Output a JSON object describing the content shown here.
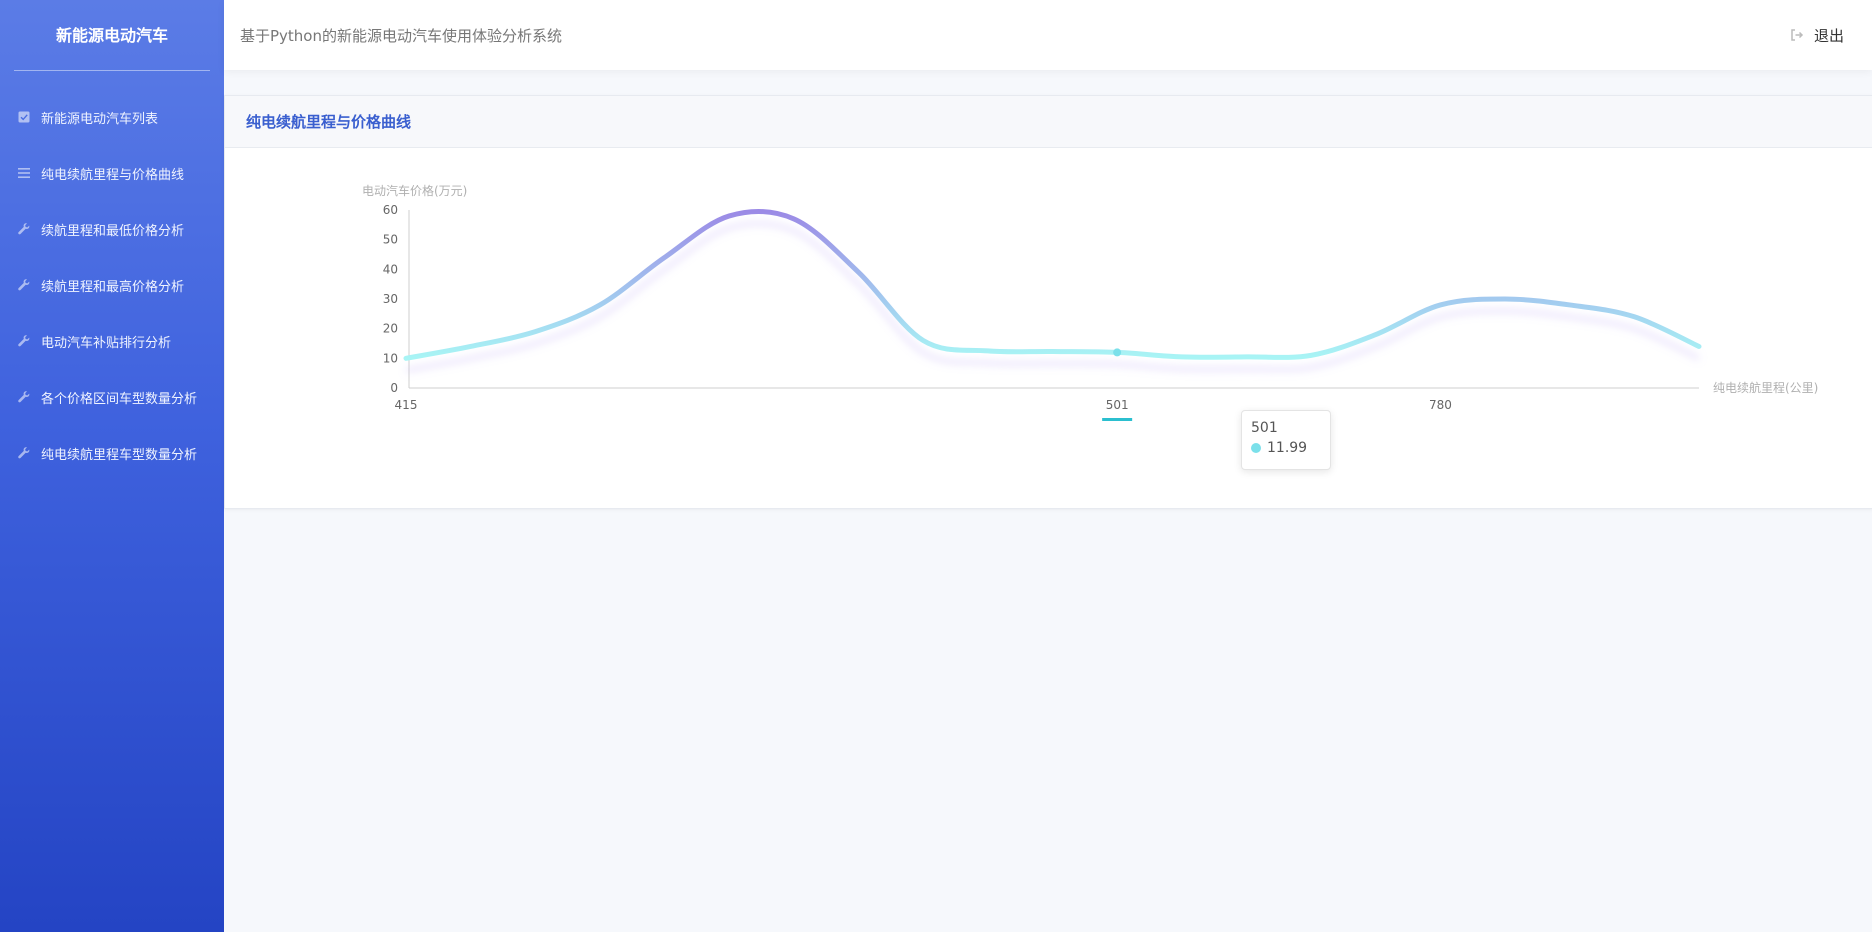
{
  "sidebar": {
    "brand": "新能源电动汽车",
    "items": [
      {
        "label": "新能源电动汽车列表",
        "icon": "checkbox-icon"
      },
      {
        "label": "纯电续航里程与价格曲线",
        "icon": "list-icon"
      },
      {
        "label": "续航里程和最低价格分析",
        "icon": "wrench-icon"
      },
      {
        "label": "续航里程和最高价格分析",
        "icon": "wrench-icon"
      },
      {
        "label": "电动汽车补贴排行分析",
        "icon": "wrench-icon"
      },
      {
        "label": "各个价格区间车型数量分析",
        "icon": "wrench-icon"
      },
      {
        "label": "纯电续航里程车型数量分析",
        "icon": "wrench-icon"
      }
    ]
  },
  "header": {
    "title": "基于Python的新能源电动汽车使用体验分析系统",
    "logout_label": "退出",
    "logout_icon": "sign-out-icon"
  },
  "panel": {
    "title": "纯电续航里程与价格曲线"
  },
  "chart_data": {
    "type": "line",
    "ylabel": "电动汽车价格(万元)",
    "xlabel": "纯电续航里程(公里)",
    "yticks": [
      0,
      10,
      20,
      30,
      40,
      50,
      60
    ],
    "ylim": [
      0,
      60
    ],
    "xtick_labels": [
      "415",
      "501",
      "780"
    ],
    "series": [
      {
        "values": [
          10,
          14,
          19,
          28,
          44,
          58,
          57,
          39,
          16,
          12.5,
          12.3,
          11.99,
          10.5,
          10.5,
          11,
          18,
          28,
          30,
          28,
          24,
          14
        ]
      }
    ],
    "gradient": [
      "#a8f5f5",
      "#9b8ae6"
    ],
    "highlight": {
      "x_label": "501",
      "value": "11.99",
      "point_index": 11
    },
    "smooth": true,
    "grid": false
  }
}
